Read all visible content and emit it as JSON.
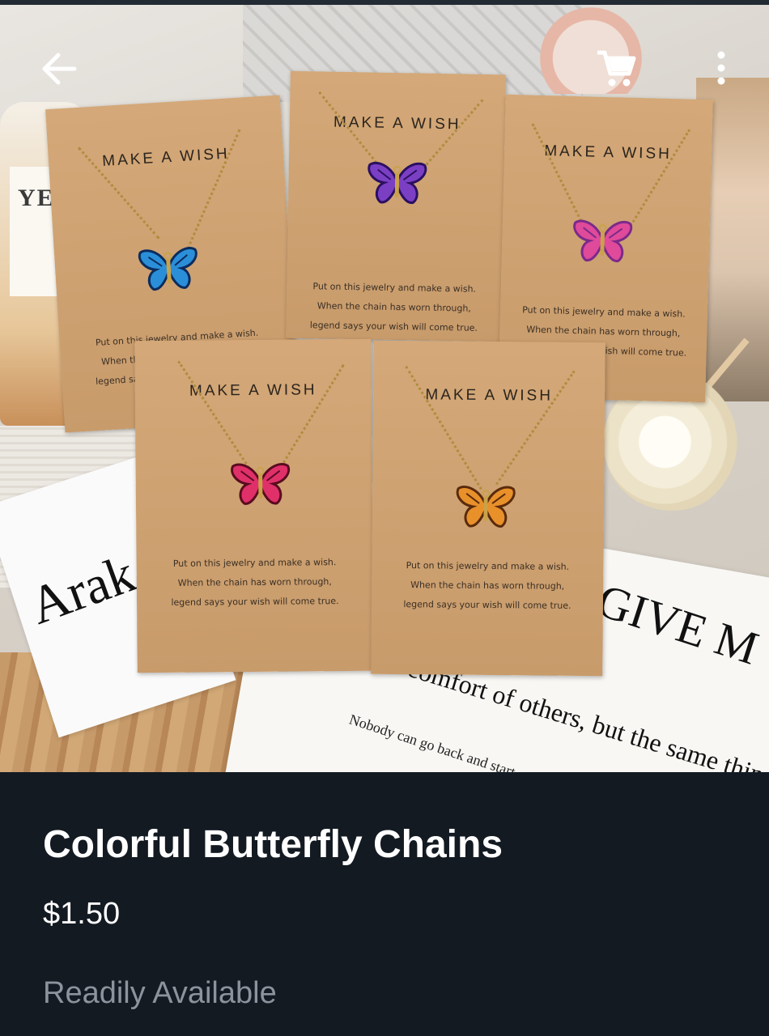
{
  "header": {
    "back_icon": "arrow-left-icon",
    "cart_icon": "shopping-cart-icon",
    "menu_icon": "more-vertical-icon"
  },
  "product_image": {
    "card_heading": "MAKE A WISH",
    "card_verse": [
      "Put on this jewelry and make a wish.",
      "When the chain has worn through,",
      "legend says your wish will come true."
    ],
    "background_text": {
      "bottle_label": "YE WA RO",
      "magazine_title": "Arak",
      "paper_line1": "GIVE M",
      "paper_line2": "comfort of others, but the same thing we c",
      "paper_line3": "Nobody can go back and start a new beginning"
    },
    "butterflies": [
      {
        "color": "#2a8fd8",
        "accent": "#0b2c5e"
      },
      {
        "color": "#7b3fc4",
        "accent": "#2a1060"
      },
      {
        "color": "#e04a9a",
        "accent": "#7a2a8a"
      },
      {
        "color": "#e0306a",
        "accent": "#5a0c20"
      },
      {
        "color": "#e8902a",
        "accent": "#5a2a0c"
      }
    ]
  },
  "product": {
    "title": "Colorful Butterfly Chains",
    "price": "$1.50",
    "availability": "Readily Available"
  },
  "colors": {
    "panel_bg": "#131a22",
    "text_primary": "#ffffff",
    "text_muted": "#8c939c"
  }
}
